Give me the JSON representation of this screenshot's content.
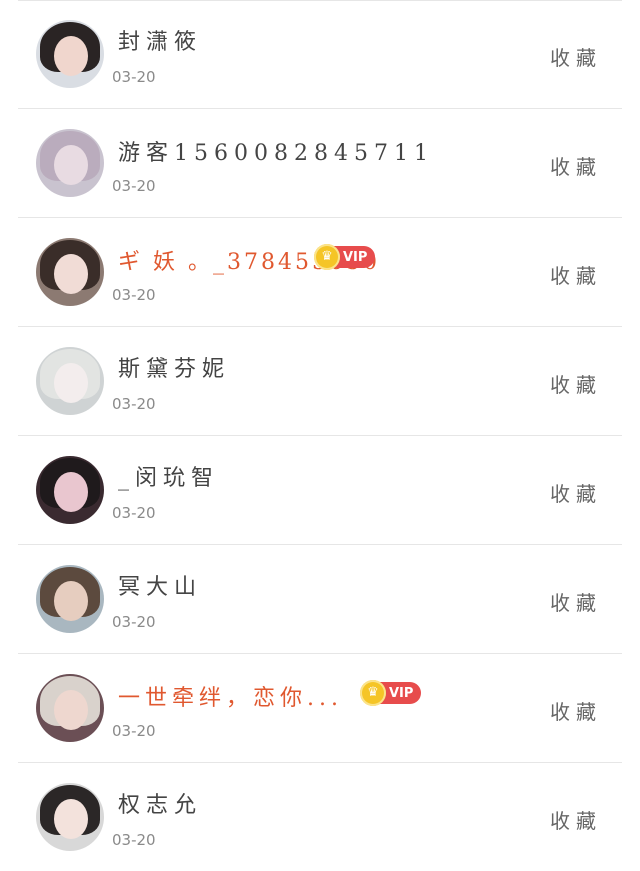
{
  "items": [
    {
      "name": "封潇筱",
      "date": "03-20",
      "action": "收藏"
    },
    {
      "name": "游客1560082845711",
      "date": "03-20",
      "action": "收藏"
    },
    {
      "name": "ギ 妖 。_378455650",
      "date": "03-20",
      "action": "收藏",
      "vip": "VIP"
    },
    {
      "name": "斯黛芬妮",
      "date": "03-20",
      "action": "收藏"
    },
    {
      "name": "_闵玧智",
      "date": "03-20",
      "action": "收藏"
    },
    {
      "name": "冥大山",
      "date": "03-20",
      "action": "收藏"
    },
    {
      "name": "一世牵绊，恋你...",
      "date": "03-20",
      "action": "收藏",
      "vip": "VIP"
    },
    {
      "name": "权志允",
      "date": "03-20",
      "action": "收藏"
    }
  ],
  "icons": {
    "vip_crown": "crown-icon"
  },
  "colors": {
    "vip_name": "#e0582f",
    "vip_badge": "#e74c4c",
    "crown": "#f5c526"
  }
}
